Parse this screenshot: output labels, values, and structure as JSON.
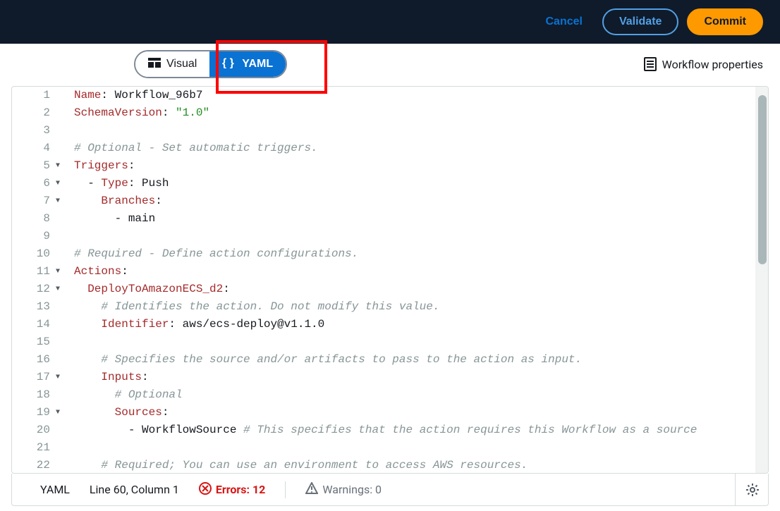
{
  "topbar": {
    "cancel": "Cancel",
    "validate": "Validate",
    "commit": "Commit"
  },
  "toolbar": {
    "visual": "Visual",
    "yaml": "YAML",
    "workflow_properties": "Workflow properties"
  },
  "editor": {
    "lines": [
      {
        "n": 1,
        "fold": "",
        "tokens": [
          [
            "key",
            "Name"
          ],
          [
            "punct",
            ": "
          ],
          [
            "val",
            "Workflow_96b7"
          ]
        ]
      },
      {
        "n": 2,
        "fold": "",
        "tokens": [
          [
            "key",
            "SchemaVersion"
          ],
          [
            "punct",
            ": "
          ],
          [
            "str",
            "\"1.0\""
          ]
        ]
      },
      {
        "n": 3,
        "fold": "",
        "tokens": []
      },
      {
        "n": 4,
        "fold": "",
        "tokens": [
          [
            "comment",
            "# Optional - Set automatic triggers."
          ]
        ]
      },
      {
        "n": 5,
        "fold": "▼",
        "tokens": [
          [
            "key",
            "Triggers"
          ],
          [
            "punct",
            ":"
          ]
        ]
      },
      {
        "n": 6,
        "fold": "▼",
        "tokens": [
          [
            "punct",
            "  - "
          ],
          [
            "key",
            "Type"
          ],
          [
            "punct",
            ": "
          ],
          [
            "val",
            "Push"
          ]
        ]
      },
      {
        "n": 7,
        "fold": "▼",
        "tokens": [
          [
            "val",
            "    "
          ],
          [
            "key",
            "Branches"
          ],
          [
            "punct",
            ":"
          ]
        ]
      },
      {
        "n": 8,
        "fold": "",
        "tokens": [
          [
            "punct",
            "      - "
          ],
          [
            "val",
            "main"
          ]
        ]
      },
      {
        "n": 9,
        "fold": "",
        "tokens": []
      },
      {
        "n": 10,
        "fold": "",
        "tokens": [
          [
            "comment",
            "# Required - Define action configurations."
          ]
        ]
      },
      {
        "n": 11,
        "fold": "▼",
        "tokens": [
          [
            "key",
            "Actions"
          ],
          [
            "punct",
            ":"
          ]
        ]
      },
      {
        "n": 12,
        "fold": "▼",
        "tokens": [
          [
            "val",
            "  "
          ],
          [
            "key",
            "DeployToAmazonECS_d2"
          ],
          [
            "punct",
            ":"
          ]
        ]
      },
      {
        "n": 13,
        "fold": "",
        "tokens": [
          [
            "val",
            "    "
          ],
          [
            "comment",
            "# Identifies the action. Do not modify this value."
          ]
        ]
      },
      {
        "n": 14,
        "fold": "",
        "tokens": [
          [
            "val",
            "    "
          ],
          [
            "key",
            "Identifier"
          ],
          [
            "punct",
            ": "
          ],
          [
            "val",
            "aws/ecs-deploy@v1.1.0"
          ]
        ]
      },
      {
        "n": 15,
        "fold": "",
        "tokens": []
      },
      {
        "n": 16,
        "fold": "",
        "tokens": [
          [
            "val",
            "    "
          ],
          [
            "comment",
            "# Specifies the source and/or artifacts to pass to the action as input."
          ]
        ]
      },
      {
        "n": 17,
        "fold": "▼",
        "tokens": [
          [
            "val",
            "    "
          ],
          [
            "key",
            "Inputs"
          ],
          [
            "punct",
            ":"
          ]
        ]
      },
      {
        "n": 18,
        "fold": "",
        "tokens": [
          [
            "val",
            "      "
          ],
          [
            "comment",
            "# Optional"
          ]
        ]
      },
      {
        "n": 19,
        "fold": "▼",
        "tokens": [
          [
            "val",
            "      "
          ],
          [
            "key",
            "Sources"
          ],
          [
            "punct",
            ":"
          ]
        ]
      },
      {
        "n": 20,
        "fold": "",
        "tokens": [
          [
            "punct",
            "        - "
          ],
          [
            "val",
            "WorkflowSource "
          ],
          [
            "comment",
            "# This specifies that the action requires this Workflow as a source"
          ]
        ]
      },
      {
        "n": 21,
        "fold": "",
        "tokens": []
      },
      {
        "n": 22,
        "fold": "",
        "tokens": [
          [
            "val",
            "    "
          ],
          [
            "comment",
            "# Required; You can use an environment to access AWS resources."
          ]
        ]
      }
    ]
  },
  "status": {
    "mode": "YAML",
    "position": "Line 60, Column 1",
    "errors_label": "Errors: 12",
    "warnings_label": "Warnings: 0"
  }
}
